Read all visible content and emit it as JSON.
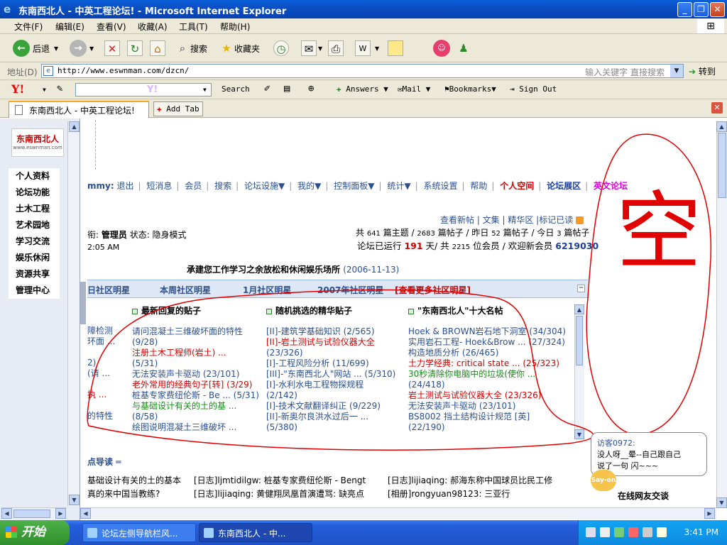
{
  "window": {
    "title": "东南西北人 - 中英工程论坛! - Microsoft Internet Explorer"
  },
  "menu": [
    "文件(F)",
    "编辑(E)",
    "查看(V)",
    "收藏(A)",
    "工具(T)",
    "帮助(H)"
  ],
  "toolbar": {
    "back": "后退",
    "search": "搜索",
    "favorites": "收藏夹"
  },
  "address": {
    "label": "地址(D)",
    "url": "http://www.eswnman.com/dzcn/",
    "hint": "输入关键字 直接搜索",
    "go": "转到"
  },
  "ytoolbar": {
    "logo": "Y!",
    "search": "Search",
    "answers": "Answers",
    "mail": "Mail",
    "bookmarks": "Bookmarks",
    "signout": "Sign Out"
  },
  "tabs": {
    "active": "东南西北人 - 中英工程论坛!",
    "add": "Add Tab"
  },
  "sidebar": {
    "logo_title": "东南西北人",
    "logo_sub": "www.eswnman.com",
    "items": [
      "个人资料",
      "论坛功能",
      "土木工程",
      "艺术园地",
      "学习交流",
      "娱乐休闲",
      "资源共享",
      "管理中心"
    ]
  },
  "forum": {
    "navbar": {
      "user": "mmy:",
      "links": [
        "退出",
        "短消息",
        "会员",
        "搜索",
        "论坛设施▼",
        "我的▼",
        "控制面板▼",
        "统计▼",
        "系统设置",
        "帮助"
      ],
      "space": "个人空间",
      "show": "论坛展区",
      "english": "英文论坛"
    },
    "toplinks": "查看新帖 | 文集 | 精华区 |标记已读",
    "stats1_a": "共 ",
    "stats1_b": "641",
    "stats1_c": " 篇主题 / ",
    "stats1_d": "2683",
    "stats1_e": " 篇帖子 / 昨日 ",
    "stats1_f": "52",
    "stats1_g": " 篇帖子 / 今日 ",
    "stats1_h": "3",
    "stats1_i": " 篇帖子",
    "stats2_a": "论坛已运行 ",
    "stats2_b": "191",
    "stats2_c": " 天/ 共 ",
    "stats2_d": "2215",
    "stats2_e": " 位会员 / 欢迎新会员 ",
    "stats2_f": "6219030",
    "status_a": "衔: ",
    "status_b": "管理员",
    "status_c": " 状态: 隐身模式",
    "time": "2:05 AM",
    "slogan": "承建您工作学习之余放松和休闲娱乐场所",
    "slogan_date": "(2006-11-13)",
    "starbar": [
      "日社区明星",
      "本周社区明星",
      "1月社区明星",
      "2007年社区明星",
      "[查看更多社区明星]"
    ],
    "col0": [
      "障检测",
      "环面 ...",
      "",
      "2)",
      "(请 ...",
      "",
      "执 ...",
      "",
      "的特性"
    ],
    "col1_title": "最新回复的贴子",
    "col1": [
      {
        "t": "请问混凝土三维破坏面的特性",
        "c": ""
      },
      {
        "t": "(9/28)",
        "c": ""
      },
      {
        "t": "注册土木工程师(岩土) ...",
        "c": "red"
      },
      {
        "t": "(5/31)",
        "c": ""
      },
      {
        "t": "无法安装声卡驱动 (23/101)",
        "c": ""
      },
      {
        "t": "老外常用的经典句子[转] (3/29)",
        "c": "red"
      },
      {
        "t": "桩基专家费纽伦斯 - Be ... (5/31)",
        "c": ""
      },
      {
        "t": "与基础设计有关的土的基 ...",
        "c": "green"
      },
      {
        "t": "(8/58)",
        "c": ""
      },
      {
        "t": "绘图说明混凝土三维破坏 ...",
        "c": ""
      }
    ],
    "col2_title": "随机挑选的精华贴子",
    "col2": [
      {
        "t": "[II]-建筑学基础知识 (2/565)",
        "c": ""
      },
      {
        "t": "[II]-岩土测试与试验仪器大全",
        "c": "red"
      },
      {
        "t": "(23/326)",
        "c": ""
      },
      {
        "t": "[I]-工程风险分析 (11/699)",
        "c": ""
      },
      {
        "t": "[III]-\"东南西北人\"网站 ... (5/310)",
        "c": ""
      },
      {
        "t": "[I]-水利水电工程物探规程",
        "c": ""
      },
      {
        "t": "(2/142)",
        "c": ""
      },
      {
        "t": "[I]-技术文献翻译纠正 (9/229)",
        "c": ""
      },
      {
        "t": "[II]-新奥尔良洪水过后一 ...",
        "c": ""
      },
      {
        "t": "(5/380)",
        "c": ""
      }
    ],
    "col3_title": "\"东南西北人\"十大名帖",
    "col3": [
      {
        "t": "Hoek & BROWN岩石地下洞室 (34/304)",
        "c": ""
      },
      {
        "t": "实用岩石工程- Hoek&Brow ... (27/324)",
        "c": ""
      },
      {
        "t": "构造地质分析 (26/465)",
        "c": ""
      },
      {
        "t": "土力学经典: critical state ... (25/323)",
        "c": "red"
      },
      {
        "t": "30秒清除你电脑中的垃圾(使你 ...",
        "c": "green"
      },
      {
        "t": "(24/418)",
        "c": ""
      },
      {
        "t": "岩土测试与试验仪器大全 (23/326)",
        "c": "red"
      },
      {
        "t": "无法安装声卡驱动 (23/101)",
        "c": ""
      },
      {
        "t": "BS8002 挡土结构设计规范 [英]",
        "c": ""
      },
      {
        "t": "(22/190)",
        "c": ""
      }
    ],
    "guide": "点导读 ═",
    "blogs": [
      [
        "基础设计有关的土的基本",
        "[日志]ljmtidilgw: 桩基专家费纽伦斯 - Bengt",
        "[日志]lijiaqing: 郝海东称中国球员比民工修"
      ],
      [
        "真的来中国当教练?",
        "[日志]lijiaqing: 黄健翔凤凰首演遭骂: 缺亮点",
        "[相册]rongyuan98123: 三亚行"
      ]
    ]
  },
  "chat": {
    "who": "访客0972:",
    "line1": "没人呀__晕--自己跟自己",
    "line2": "说了一句 闪~~~",
    "say": "Say-on",
    "online": "在线网友交谈"
  },
  "taskbar": {
    "start": "开始",
    "task1": "论坛左侧导航栏风...",
    "task2": "东南西北人 - 中...",
    "clock": "3:41 PM"
  },
  "annotation": "空",
  "colors": {
    "title": "#0a5fd8",
    "red": "#d00000",
    "link": "#2b4f8f",
    "annotation": "#e00000"
  }
}
